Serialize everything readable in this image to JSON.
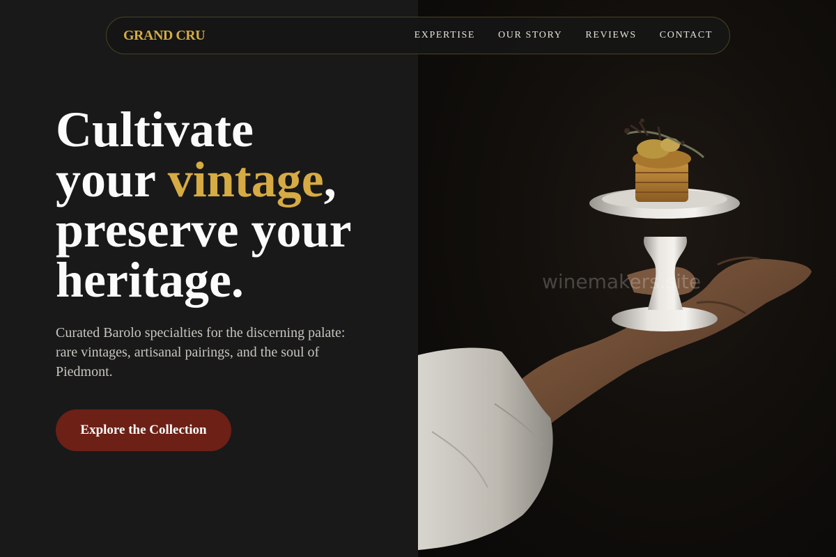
{
  "brand": {
    "logo": "GRAND CRU",
    "accent_color": "#d6ab44"
  },
  "nav": {
    "items": [
      "EXPERTISE",
      "OUR STORY",
      "REVIEWS",
      "CONTACT"
    ]
  },
  "hero": {
    "line1": "Cultivate",
    "line2_pre": "your ",
    "line2_accent": "vintage",
    "line2_post": ",",
    "line3": "preserve your",
    "line4": "heritage.",
    "subtext": "Curated Barolo specialties for the discerning palate: rare vintages, artisanal pairings, and the soul of Piedmont.",
    "cta_label": "Explore the Collection",
    "cta_color": "#6c2016"
  },
  "image": {
    "subject": "hand-holding-appetizer-on-pedestal-plate",
    "watermark": "winemakers.site"
  }
}
